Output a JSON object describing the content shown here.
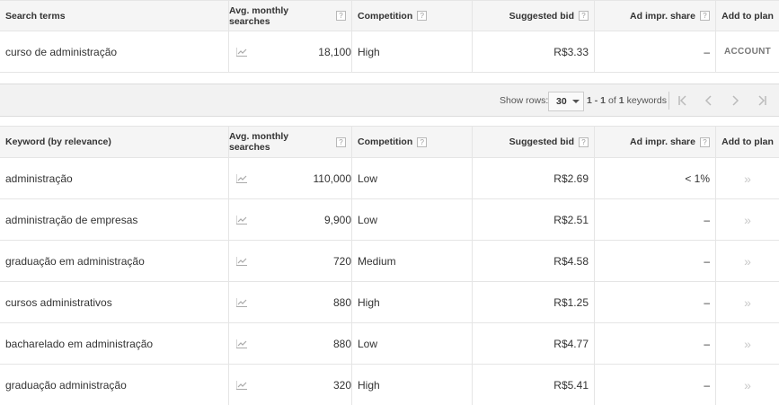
{
  "search_table": {
    "headers": {
      "term": "Search terms",
      "avg": "Avg. monthly searches",
      "competition": "Competition",
      "bid": "Suggested bid",
      "share": "Ad impr. share",
      "plan": "Add to plan"
    },
    "help_mark": "?",
    "rows": [
      {
        "term": "curso de administração",
        "avg": "18,100",
        "competition": "High",
        "bid": "R$3.33",
        "share": "–",
        "plan": "ACCOUNT"
      }
    ]
  },
  "pager": {
    "show_rows_label": "Show rows:",
    "rows_value": "30",
    "range_start": "1 - 1",
    "range_of": "of",
    "range_total": "1",
    "range_suffix": "keywords"
  },
  "keyword_table": {
    "headers": {
      "term": "Keyword (by relevance)",
      "avg": "Avg. monthly searches",
      "competition": "Competition",
      "bid": "Suggested bid",
      "share": "Ad impr. share",
      "plan": "Add to plan"
    },
    "add_glyph": "»",
    "rows": [
      {
        "term": "administração",
        "avg": "110,000",
        "competition": "Low",
        "bid": "R$2.69",
        "share": "< 1%"
      },
      {
        "term": "administração de empresas",
        "avg": "9,900",
        "competition": "Low",
        "bid": "R$2.51",
        "share": "–"
      },
      {
        "term": "graduação em administração",
        "avg": "720",
        "competition": "Medium",
        "bid": "R$4.58",
        "share": "–"
      },
      {
        "term": "cursos administrativos",
        "avg": "880",
        "competition": "High",
        "bid": "R$1.25",
        "share": "–"
      },
      {
        "term": "bacharelado em administração",
        "avg": "880",
        "competition": "Low",
        "bid": "R$4.77",
        "share": "–"
      },
      {
        "term": "graduação administração",
        "avg": "320",
        "competition": "High",
        "bid": "R$5.41",
        "share": "–"
      }
    ]
  },
  "icons": {
    "trend": "trend-chart-icon",
    "help": "help-question-icon",
    "first": "first-page-icon",
    "prev": "previous-page-icon",
    "next": "next-page-icon",
    "last": "last-page-icon",
    "add": "add-to-plan-chevron-icon"
  }
}
